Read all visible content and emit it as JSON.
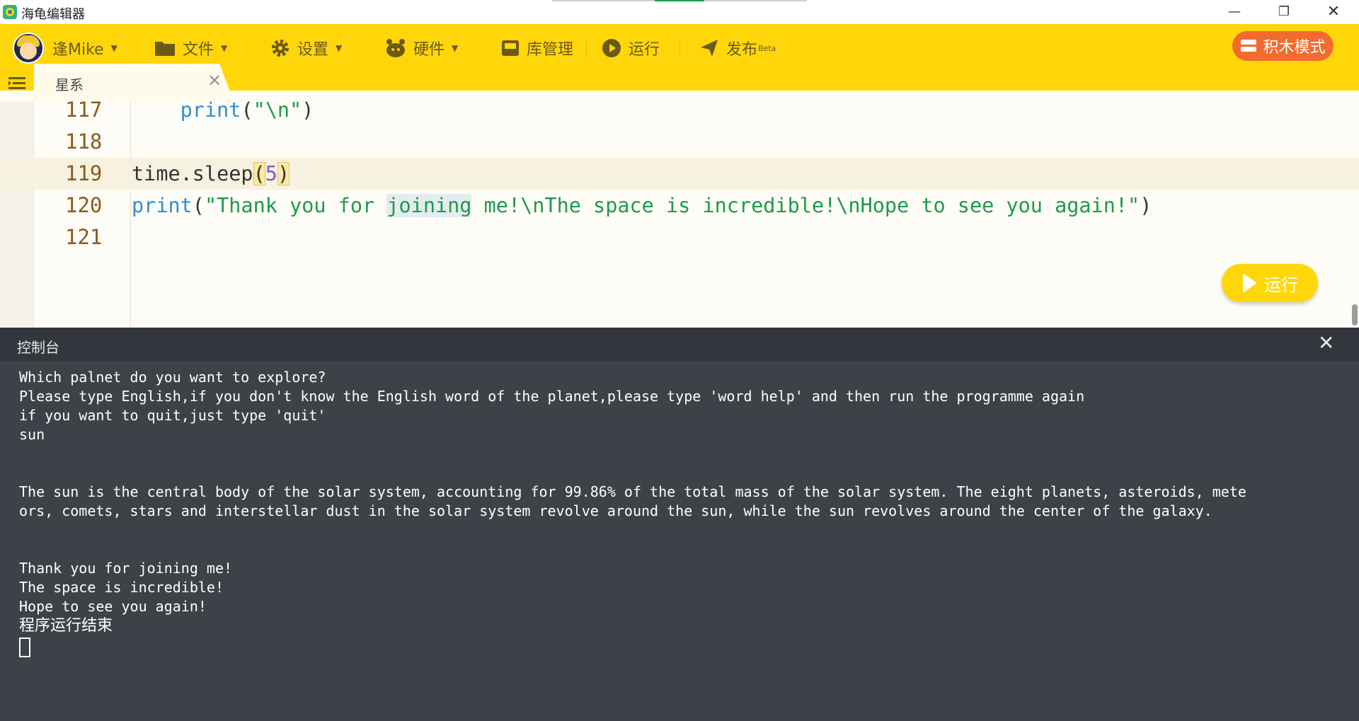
{
  "window": {
    "title": "海龟编辑器",
    "controls": {
      "minimize": "—",
      "restore": "❐",
      "close": "✕"
    }
  },
  "menubar": {
    "user": "逢Mike",
    "file": "文件",
    "settings": "设置",
    "hardware": "硬件",
    "library": "库管理",
    "run": "运行",
    "publish": "发布",
    "publish_badge": "Beta",
    "blocks_mode": "积木模式"
  },
  "tabs": [
    {
      "label": "星系",
      "close": "✕"
    }
  ],
  "editor": {
    "active_line": 119,
    "lines": [
      {
        "num": "117",
        "indent": "    ",
        "fn": "print",
        "open": "(",
        "str": "\"\\n\"",
        "close": ")"
      },
      {
        "num": "118"
      },
      {
        "num": "119",
        "obj": "time.sleep",
        "open": "(",
        "arg": "5",
        "close": ")"
      },
      {
        "num": "120",
        "fn": "print",
        "open": "(",
        "str_a": "\"Thank you for ",
        "str_hl": "joining",
        "str_b": " me!\\nThe space is incredible!\\nHope to see you again!\"",
        "close": ")"
      },
      {
        "num": "121"
      }
    ],
    "run_button": "运行"
  },
  "console": {
    "title": "控制台",
    "close": "✕",
    "lines": [
      "Which palnet do you want to explore?",
      "Please type English,if you don't know the English word of the planet,please type 'word help' and then run the programme again",
      "if you want to quit,just type 'quit'",
      "sun",
      "",
      "",
      "The sun is the central body of the solar system, accounting for 99.86% of the total mass of the solar system. The eight planets, asteroids, mete",
      "ors, comets, stars and interstellar dust in the solar system revolve around the sun, while the sun revolves around the center of the galaxy.",
      "",
      "",
      "Thank you for joining me!",
      "The space is incredible!",
      "Hope to see you again!",
      "程序运行结束"
    ]
  },
  "colors": {
    "accent": "#ffd60a",
    "blocks_button": "#f26a2e",
    "console_bg": "#3e4148"
  }
}
